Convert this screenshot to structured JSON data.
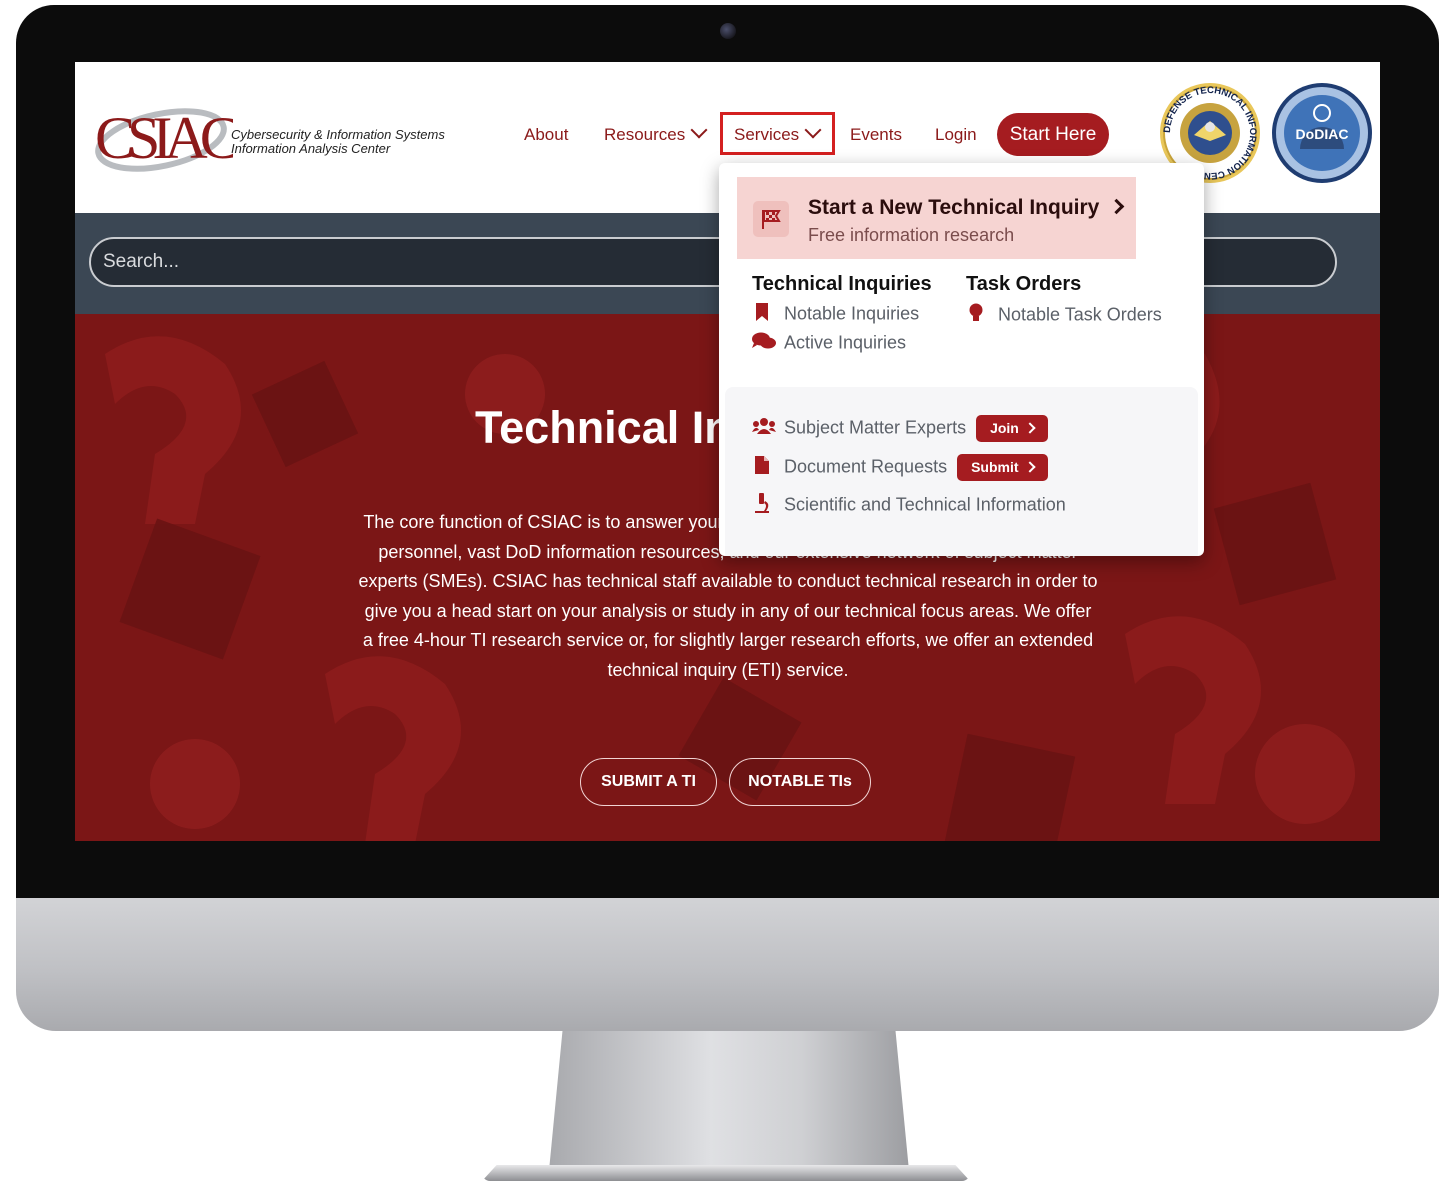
{
  "brand": {
    "logo_text": "CSIAC",
    "caption_line1": "Cybersecurity & Information Systems",
    "caption_line2": "Information Analysis Center"
  },
  "nav": {
    "about": "About",
    "resources": "Resources",
    "services": "Services",
    "events": "Events",
    "login": "Login",
    "start_here": "Start Here"
  },
  "seals": {
    "dtic_text": "DEFENSE TECHNICAL INFORMATION CENTER",
    "dodiac_text": "DoDIAC"
  },
  "search": {
    "placeholder": "Search..."
  },
  "hero": {
    "title": "Technical Inquiries",
    "body": "The core function of CSIAC is to answer your technical questions by leveraging its technical personnel, vast DoD information resources, and our extensive network of subject matter experts (SMEs). CSIAC has technical staff available to conduct technical research in order to give you a head start on your analysis or study in any of our technical focus areas. We offer a free 4-hour TI research service or, for slightly larger research efforts, we offer an extended technical inquiry (ETI) service.",
    "submit_button": "SUBMIT A TI",
    "notable_button": "NOTABLE TIs"
  },
  "dropdown": {
    "cta_title": "Start a New Technical Inquiry",
    "cta_subtitle": "Free information research",
    "col1_heading": "Technical Inquiries",
    "col1_links": [
      "Notable Inquiries",
      "Active Inquiries"
    ],
    "col2_heading": "Task Orders",
    "col2_links": [
      "Notable Task Orders"
    ],
    "sme_label": "Subject Matter Experts",
    "sme_button": "Join",
    "doc_label": "Document Requests",
    "doc_button": "Submit",
    "sti_label": "Scientific and Technical Information"
  },
  "colors": {
    "brand_red": "#a51c20",
    "highlight_box": "#d42020",
    "header_band": "#3b4754",
    "hero_red": "#7b1616"
  }
}
